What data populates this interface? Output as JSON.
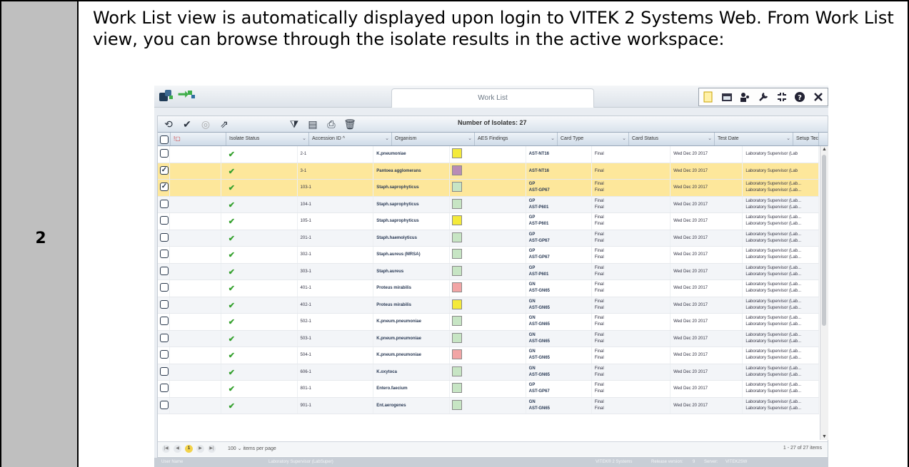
{
  "step": "2",
  "instruction": "Work List view is automatically displayed upon login to VITEK 2 Systems Web. From Work List view, you can browse through the isolate results in the active workspace:",
  "app": {
    "tab_title": "Work List",
    "isolate_count": "Number of Isolates: 27",
    "columns": [
      "",
      "",
      "Isolate Status",
      "Accession ID ^",
      "Organism",
      "AES Findings",
      "Card Type",
      "Card Status",
      "Test Date",
      "Setup Tech"
    ],
    "rows": [
      {
        "checked": false,
        "selected": false,
        "accession": "2-1",
        "organism": "K.pneumoniae",
        "aes_color": "#f4ea3a",
        "card1": "AST-NT16",
        "card2": "",
        "status1": "Final",
        "status2": "",
        "date": "Wed Dec 20 2017",
        "tech1": "Laboratory Supervisor (Lab",
        "tech2": ""
      },
      {
        "checked": true,
        "selected": true,
        "accession": "3-1",
        "organism": "Pantoea agglomerans",
        "aes_color": "#b98cb6",
        "card1": "AST-NT16",
        "card2": "",
        "status1": "Final",
        "status2": "",
        "date": "Wed Dec 20 2017",
        "tech1": "Laboratory Supervisor (Lab",
        "tech2": ""
      },
      {
        "checked": true,
        "selected": true,
        "accession": "103-1",
        "organism": "Staph.saprophyticus",
        "aes_color": "#c7e5c4",
        "card1": "GP",
        "card2": "AST-GP67",
        "status1": "Final",
        "status2": "Final",
        "date": "Wed Dec 20 2017",
        "tech1": "Laboratory Supervisor (Lab...",
        "tech2": "Laboratory Supervisor (Lab..."
      },
      {
        "checked": false,
        "selected": false,
        "accession": "104-1",
        "organism": "Staph.saprophyticus",
        "aes_color": "#c7e5c4",
        "card1": "GP",
        "card2": "AST-P601",
        "status1": "Final",
        "status2": "Final",
        "date": "Wed Dec 20 2017",
        "tech1": "Laboratory Supervisor (Lab...",
        "tech2": "Laboratory Supervisor (Lab..."
      },
      {
        "checked": false,
        "selected": false,
        "accession": "105-1",
        "organism": "Staph.saprophyticus",
        "aes_color": "#f4ea3a",
        "card1": "GP",
        "card2": "AST-P601",
        "status1": "Final",
        "status2": "Final",
        "date": "Wed Dec 20 2017",
        "tech1": "Laboratory Supervisor (Lab...",
        "tech2": "Laboratory Supervisor (Lab..."
      },
      {
        "checked": false,
        "selected": false,
        "accession": "201-1",
        "organism": "Staph.haemolyticus",
        "aes_color": "#c7e5c4",
        "card1": "GP",
        "card2": "AST-GP67",
        "status1": "Final",
        "status2": "Final",
        "date": "Wed Dec 20 2017",
        "tech1": "Laboratory Supervisor (Lab...",
        "tech2": "Laboratory Supervisor (Lab..."
      },
      {
        "checked": false,
        "selected": false,
        "accession": "302-1",
        "organism": "Staph.aureus (MRSA)",
        "aes_color": "#c7e5c4",
        "card1": "GP",
        "card2": "AST-GP67",
        "status1": "Final",
        "status2": "Final",
        "date": "Wed Dec 20 2017",
        "tech1": "Laboratory Supervisor (Lab...",
        "tech2": "Laboratory Supervisor (Lab..."
      },
      {
        "checked": false,
        "selected": false,
        "accession": "303-1",
        "organism": "Staph.aureus",
        "aes_color": "#c7e5c4",
        "card1": "GP",
        "card2": "AST-P601",
        "status1": "Final",
        "status2": "Final",
        "date": "Wed Dec 20 2017",
        "tech1": "Laboratory Supervisor (Lab...",
        "tech2": "Laboratory Supervisor (Lab..."
      },
      {
        "checked": false,
        "selected": false,
        "accession": "401-1",
        "organism": "Proteus mirabilis",
        "aes_color": "#f2a5a5",
        "card1": "GN",
        "card2": "AST-GN65",
        "status1": "Final",
        "status2": "Final",
        "date": "Wed Dec 20 2017",
        "tech1": "Laboratory Supervisor (Lab...",
        "tech2": "Laboratory Supervisor (Lab..."
      },
      {
        "checked": false,
        "selected": false,
        "accession": "402-1",
        "organism": "Proteus mirabilis",
        "aes_color": "#f4ea3a",
        "card1": "GN",
        "card2": "AST-GN65",
        "status1": "Final",
        "status2": "Final",
        "date": "Wed Dec 20 2017",
        "tech1": "Laboratory Supervisor (Lab...",
        "tech2": "Laboratory Supervisor (Lab..."
      },
      {
        "checked": false,
        "selected": false,
        "accession": "502-1",
        "organism": "K.pneum.pneumoniae",
        "aes_color": "#c7e5c4",
        "card1": "GN",
        "card2": "AST-GN65",
        "status1": "Final",
        "status2": "Final",
        "date": "Wed Dec 20 2017",
        "tech1": "Laboratory Supervisor (Lab...",
        "tech2": "Laboratory Supervisor (Lab..."
      },
      {
        "checked": false,
        "selected": false,
        "accession": "503-1",
        "organism": "K.pneum.pneumoniae",
        "aes_color": "#c7e5c4",
        "card1": "GN",
        "card2": "AST-GN65",
        "status1": "Final",
        "status2": "Final",
        "date": "Wed Dec 20 2017",
        "tech1": "Laboratory Supervisor (Lab...",
        "tech2": "Laboratory Supervisor (Lab..."
      },
      {
        "checked": false,
        "selected": false,
        "accession": "504-1",
        "organism": "K.pneum.pneumoniae",
        "aes_color": "#f2a5a5",
        "card1": "GN",
        "card2": "AST-GN65",
        "status1": "Final",
        "status2": "Final",
        "date": "Wed Dec 20 2017",
        "tech1": "Laboratory Supervisor (Lab...",
        "tech2": "Laboratory Supervisor (Lab..."
      },
      {
        "checked": false,
        "selected": false,
        "accession": "606-1",
        "organism": "K.oxytoca",
        "aes_color": "#c7e5c4",
        "card1": "GN",
        "card2": "AST-GN65",
        "status1": "Final",
        "status2": "Final",
        "date": "Wed Dec 20 2017",
        "tech1": "Laboratory Supervisor (Lab...",
        "tech2": "Laboratory Supervisor (Lab..."
      },
      {
        "checked": false,
        "selected": false,
        "accession": "801-1",
        "organism": "Entero.faecium",
        "aes_color": "#c7e5c4",
        "card1": "GP",
        "card2": "AST-GP67",
        "status1": "Final",
        "status2": "Final",
        "date": "Wed Dec 20 2017",
        "tech1": "Laboratory Supervisor (Lab...",
        "tech2": "Laboratory Supervisor (Lab..."
      },
      {
        "checked": false,
        "selected": false,
        "accession": "901-1",
        "organism": "Ent.aerogenes",
        "aes_color": "#c7e5c4",
        "card1": "GN",
        "card2": "AST-GN65",
        "status1": "Final",
        "status2": "Final",
        "date": "Wed Dec 20 2017",
        "tech1": "Laboratory Supervisor (Lab...",
        "tech2": "Laboratory Supervisor (Lab..."
      }
    ],
    "pager": {
      "current_page": "1",
      "page_size": "100",
      "items_per_page_label": "items per page",
      "count_label": "1 - 27 of 27 items"
    },
    "statusbar": {
      "user_name_label": "User Name",
      "user_name": "Laboratory Supervisor (LabSuper)",
      "product": "VITEK® 2 Systems",
      "release_label": "Release version:",
      "release": "9",
      "server_label": "Server:",
      "server": "VITEK2SW"
    },
    "colors": {
      "selected_row": "#fde79b",
      "check_green": "#33a02c",
      "page_current": "#f3d34a"
    }
  }
}
